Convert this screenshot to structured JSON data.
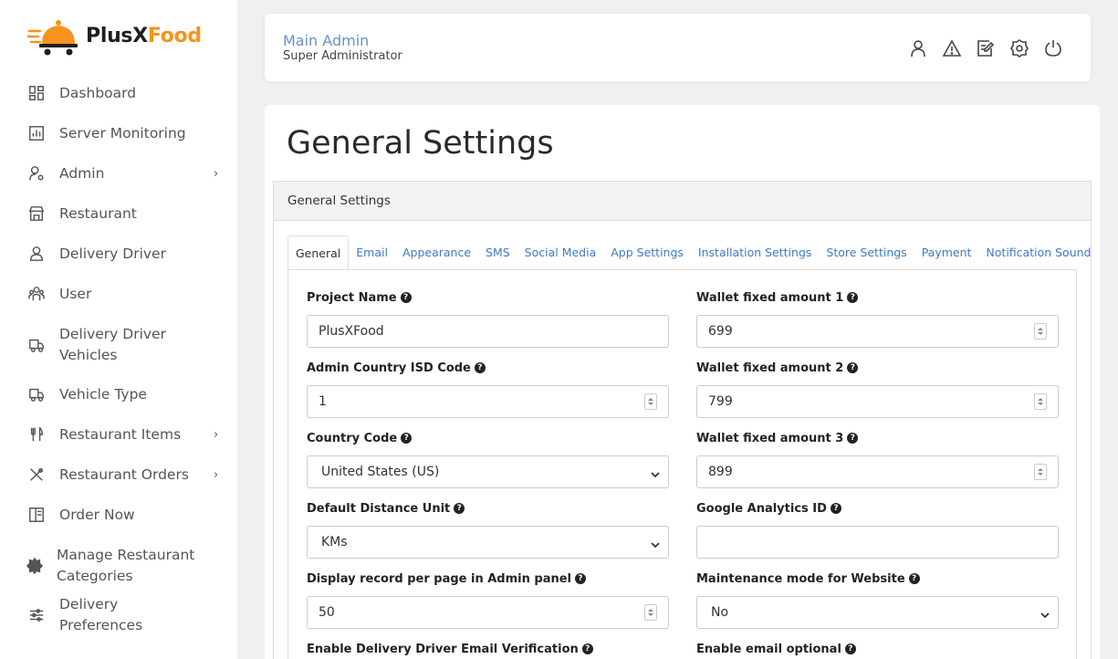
{
  "brand": {
    "name_part1": "PlusX",
    "name_part2": "Food"
  },
  "sidebar": {
    "items": [
      {
        "label": "Dashboard",
        "icon": "dashboard-icon",
        "chevron": false
      },
      {
        "label": "Server Monitoring",
        "icon": "chart-icon",
        "chevron": false
      },
      {
        "label": "Admin",
        "icon": "user-gear-icon",
        "chevron": true
      },
      {
        "label": "Restaurant",
        "icon": "store-icon",
        "chevron": false
      },
      {
        "label": "Delivery Driver",
        "icon": "driver-icon",
        "chevron": false
      },
      {
        "label": "User",
        "icon": "users-icon",
        "chevron": false
      },
      {
        "label": "Delivery Driver Vehicles",
        "icon": "truck-icon",
        "chevron": false
      },
      {
        "label": "Vehicle Type",
        "icon": "truck-icon",
        "chevron": false
      },
      {
        "label": "Restaurant Items",
        "icon": "fork-knife-icon",
        "chevron": true
      },
      {
        "label": "Restaurant Orders",
        "icon": "cross-utensils-icon",
        "chevron": true
      },
      {
        "label": "Order Now",
        "icon": "menu-book-icon",
        "chevron": false
      },
      {
        "label": "Manage Restaurant Categories",
        "icon": "gear-badge-icon",
        "chevron": false
      },
      {
        "label": "Delivery Preferences",
        "icon": "sliders-icon",
        "chevron": false
      }
    ],
    "chevron_glyph": "›"
  },
  "header": {
    "title": "Main Admin",
    "subtitle": "Super Administrator",
    "icons": [
      "user-icon",
      "warning-icon",
      "edit-icon",
      "settings-icon",
      "power-icon"
    ]
  },
  "page": {
    "title": "General Settings",
    "panel_title": "General Settings",
    "tabs": [
      "General",
      "Email",
      "Appearance",
      "SMS",
      "Social Media",
      "App Settings",
      "Installation Settings",
      "Store Settings",
      "Payment",
      "Notification Sound"
    ],
    "active_tab": "General"
  },
  "form": {
    "project_name": {
      "label": "Project Name",
      "value": "PlusXFood"
    },
    "admin_isd": {
      "label": "Admin Country ISD Code",
      "value": "1"
    },
    "country_code": {
      "label": "Country Code",
      "value": "United States (US)"
    },
    "distance_unit": {
      "label": "Default Distance Unit",
      "value": "KMs"
    },
    "records_per_page": {
      "label": "Display record per page in Admin panel",
      "value": "50"
    },
    "driver_email_verif": {
      "label": "Enable Delivery Driver Email Verification"
    },
    "wallet1": {
      "label": "Wallet fixed amount 1",
      "value": "699"
    },
    "wallet2": {
      "label": "Wallet fixed amount 2",
      "value": "799"
    },
    "wallet3": {
      "label": "Wallet fixed amount 3",
      "value": "899"
    },
    "analytics": {
      "label": "Google Analytics ID",
      "value": ""
    },
    "maintenance": {
      "label": "Maintenance mode for Website",
      "value": "No"
    },
    "email_optional": {
      "label": "Enable email optional"
    }
  },
  "help_glyph": "?"
}
